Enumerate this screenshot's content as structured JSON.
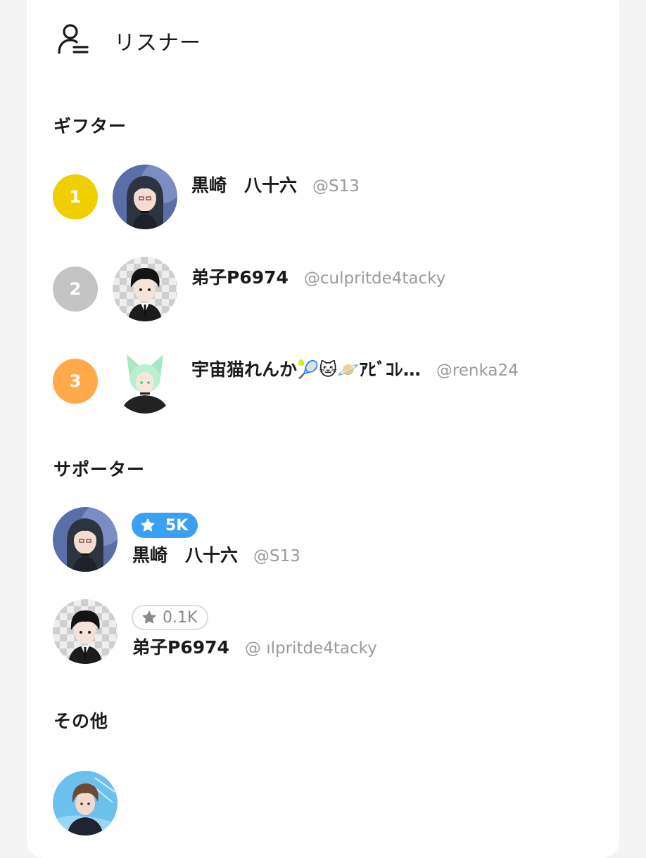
{
  "header": {
    "title": "リスナー",
    "icon": "user-list-icon"
  },
  "sections": {
    "gifters_title": "ギフター",
    "supporters_title": "サポーター",
    "others_title": "その他"
  },
  "gifters": [
    {
      "rank": "1",
      "rank_color": "#f0cf00",
      "name": "黒崎　八十六",
      "handle": "@S13"
    },
    {
      "rank": "2",
      "rank_color": "#c4c4c4",
      "name": "弟子P6974",
      "handle": "@culpritde4tacky"
    },
    {
      "rank": "3",
      "rank_color": "#ffa94a",
      "name": "宇宙猫れんか🎾🐱🪐ｱﾋﾞｺﾚ…",
      "handle": "@renka24"
    }
  ],
  "supporters": [
    {
      "badge": "5K",
      "badge_style": "blue",
      "name": "黒崎　八十六",
      "handle": "@S13"
    },
    {
      "badge": "0.1K",
      "badge_style": "gray",
      "name": "弟子P6974",
      "handle": "@ ılpritde4tacky"
    }
  ],
  "others": [
    {
      "avatar": "avatar-brown-hair"
    }
  ]
}
